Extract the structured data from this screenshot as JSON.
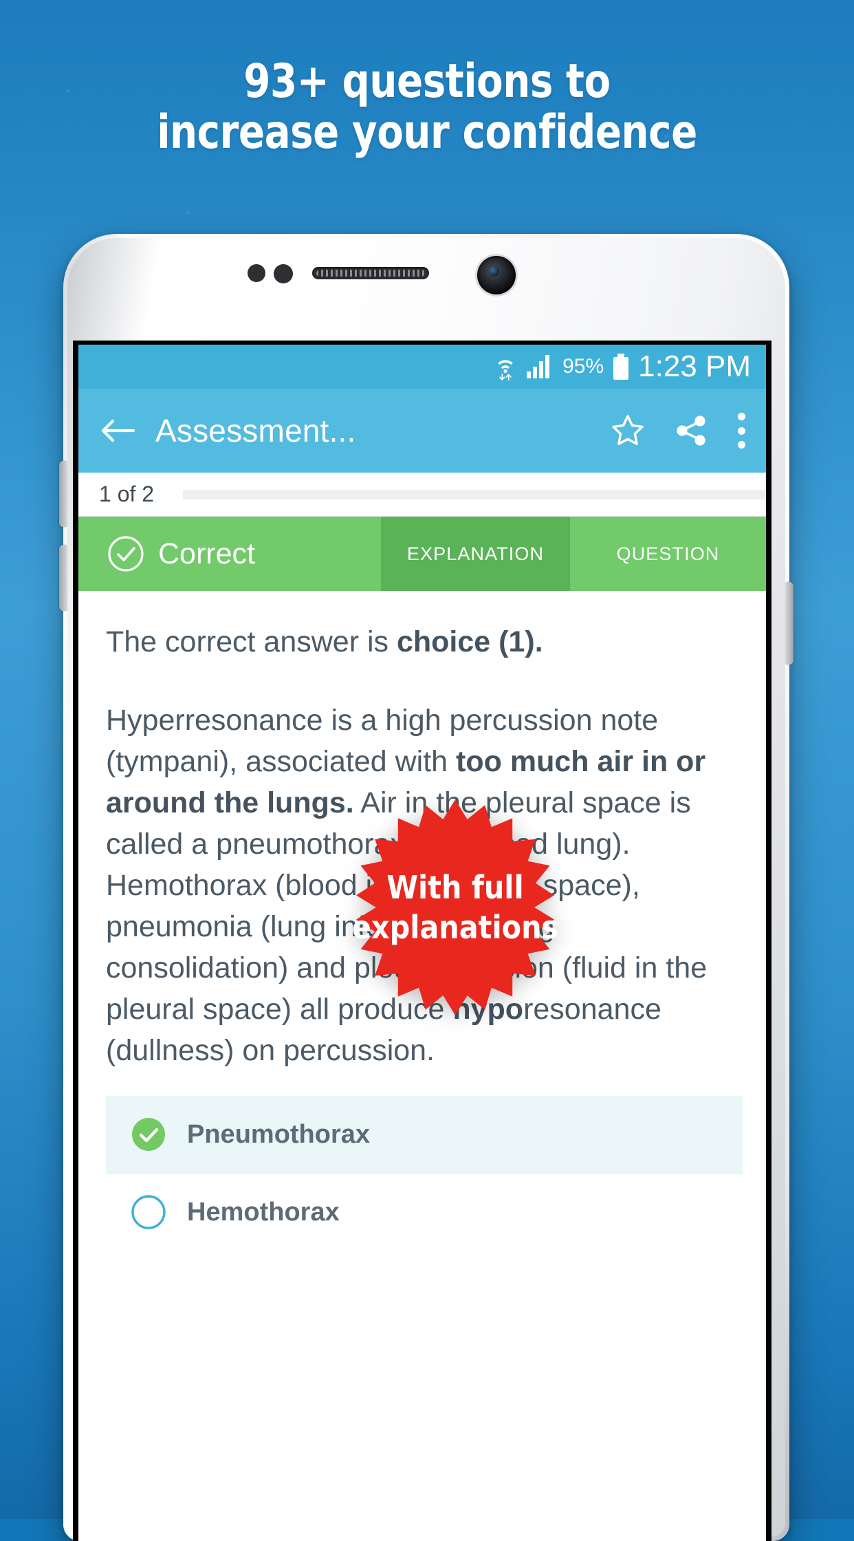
{
  "promo": {
    "headline_line1": "93+ questions to",
    "headline_line2": "increase your confidence",
    "badge_line1": "With full",
    "badge_line2": "explanations",
    "badge_color": "#e8271f",
    "background_color": "#2a8cc8"
  },
  "status_bar": {
    "battery_percent": "95%",
    "time": "1:23 PM",
    "wifi_icon": "wifi-icon",
    "signal_icon": "signal-icon",
    "battery_icon": "battery-icon"
  },
  "app_bar": {
    "back_icon": "back-arrow-icon",
    "title": "Assessment...",
    "star_icon": "star-outline-icon",
    "share_icon": "share-icon",
    "overflow_icon": "overflow-menu-icon",
    "color": "#53bbdf"
  },
  "progress": {
    "label": "1 of 2",
    "value": 1,
    "total": 2
  },
  "tabs": [
    {
      "label": "Correct",
      "icon": "check-circle-icon",
      "type": "status",
      "active": false
    },
    {
      "label": "EXPLANATION",
      "type": "tab",
      "active": true
    },
    {
      "label": "QUESTION",
      "type": "tab",
      "active": false
    }
  ],
  "explanation": {
    "paragraph1_prefix": "The correct answer is ",
    "paragraph1_bold": "choice (1).",
    "paragraph2_part1": "Hyperresonance is a high percussion note (tympani), associated with ",
    "paragraph2_bold1": "too much air in or around the lungs.",
    "paragraph2_part2": " Air in the pleural space is called a pneumothorax (collapsed lung). Hemothorax (blood in the pleural space), pneumonia (lung infection causing consolidation) and pleural effusion (fluid in the pleural space) all produce ",
    "paragraph2_bold2": "hypo",
    "paragraph2_part3": "resonance (dullness) on percussion."
  },
  "options": [
    {
      "label": "Pneumothorax",
      "state": "correct",
      "marker": "check-circle-filled-icon"
    },
    {
      "label": "Hemothorax",
      "state": "unselected",
      "marker": "radio-empty-icon"
    }
  ],
  "colors": {
    "tab_active": "#5bb357",
    "tab_inactive": "#72ca6b",
    "correct_row_bg": "#eaf6f7",
    "text": "#4b5a66"
  }
}
